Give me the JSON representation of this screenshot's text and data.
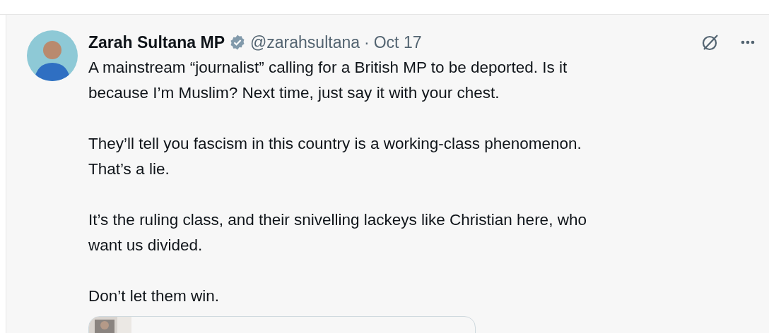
{
  "tweet": {
    "author_name": "Zarah Sultana MP",
    "verified": true,
    "handle": "@zarahsultana",
    "separator": "·",
    "date": "Oct 17",
    "paragraphs": [
      {
        "lines": [
          "A mainstream “journalist” calling for a British MP to be deported. Is it",
          "because I’m Muslim? Next time, just say it with your chest."
        ]
      },
      {
        "lines": [
          "They’ll tell you fascism in this country is a working-class phenomenon.",
          "That’s a lie."
        ]
      },
      {
        "lines": [
          "It’s the ruling class, and their snivelling lackeys like Christian here, who",
          "want us divided."
        ]
      },
      {
        "lines": [
          "Don’t let them win."
        ]
      }
    ]
  }
}
